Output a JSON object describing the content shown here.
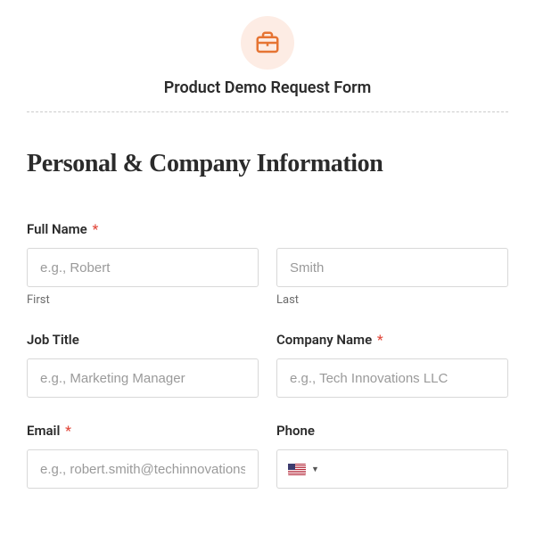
{
  "header": {
    "icon": "briefcase-icon",
    "title": "Product Demo Request Form"
  },
  "section": {
    "heading": "Personal & Company Information"
  },
  "fields": {
    "fullName": {
      "label": "Full Name",
      "required": "*",
      "first": {
        "placeholder": "e.g., Robert",
        "sublabel": "First"
      },
      "last": {
        "placeholder": "Smith",
        "sublabel": "Last"
      }
    },
    "jobTitle": {
      "label": "Job Title",
      "placeholder": "e.g., Marketing Manager"
    },
    "companyName": {
      "label": "Company Name",
      "required": "*",
      "placeholder": "e.g., Tech Innovations LLC"
    },
    "email": {
      "label": "Email",
      "required": "*",
      "placeholder": "e.g., robert.smith@techinnovations.com"
    },
    "phone": {
      "label": "Phone",
      "countryCode": "US"
    }
  }
}
